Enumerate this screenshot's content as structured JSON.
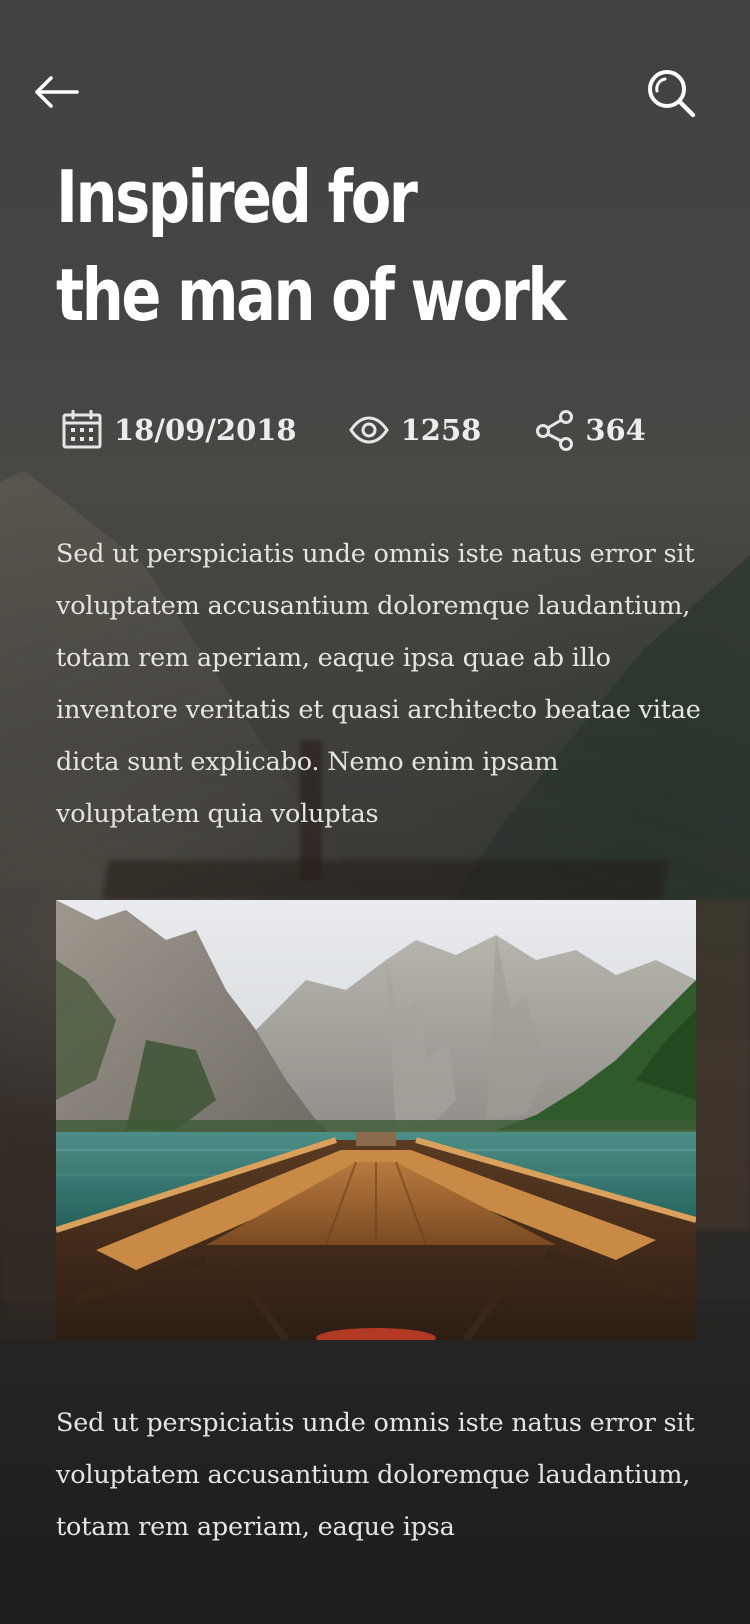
{
  "nav": {
    "back_icon": "arrow-left-icon",
    "search_icon": "search-icon"
  },
  "article": {
    "title_line1": "Inspired for",
    "title_line2": "the man of work",
    "meta": {
      "date": "18/09/2018",
      "views": "1258",
      "shares": "364",
      "date_icon": "calendar-icon",
      "views_icon": "eye-icon",
      "shares_icon": "share-icon"
    },
    "paragraph_1": "Sed ut perspiciatis unde omnis iste natus error sit voluptatem accusantium doloremque laudantium, totam rem aperiam, eaque ipsa quae ab illo inventore veritatis et quasi architecto beatae vitae dicta sunt explicabo. Nemo enim ipsam voluptatem quia voluptas",
    "paragraph_2": "Sed ut perspiciatis unde omnis iste natus error sit voluptatem accusantium doloremque laudantium, totam rem aperiam, eaque ipsa"
  },
  "colors": {
    "text_primary": "#ffffff",
    "text_body": "#e6e4e0",
    "background": "#3f3f3f"
  }
}
